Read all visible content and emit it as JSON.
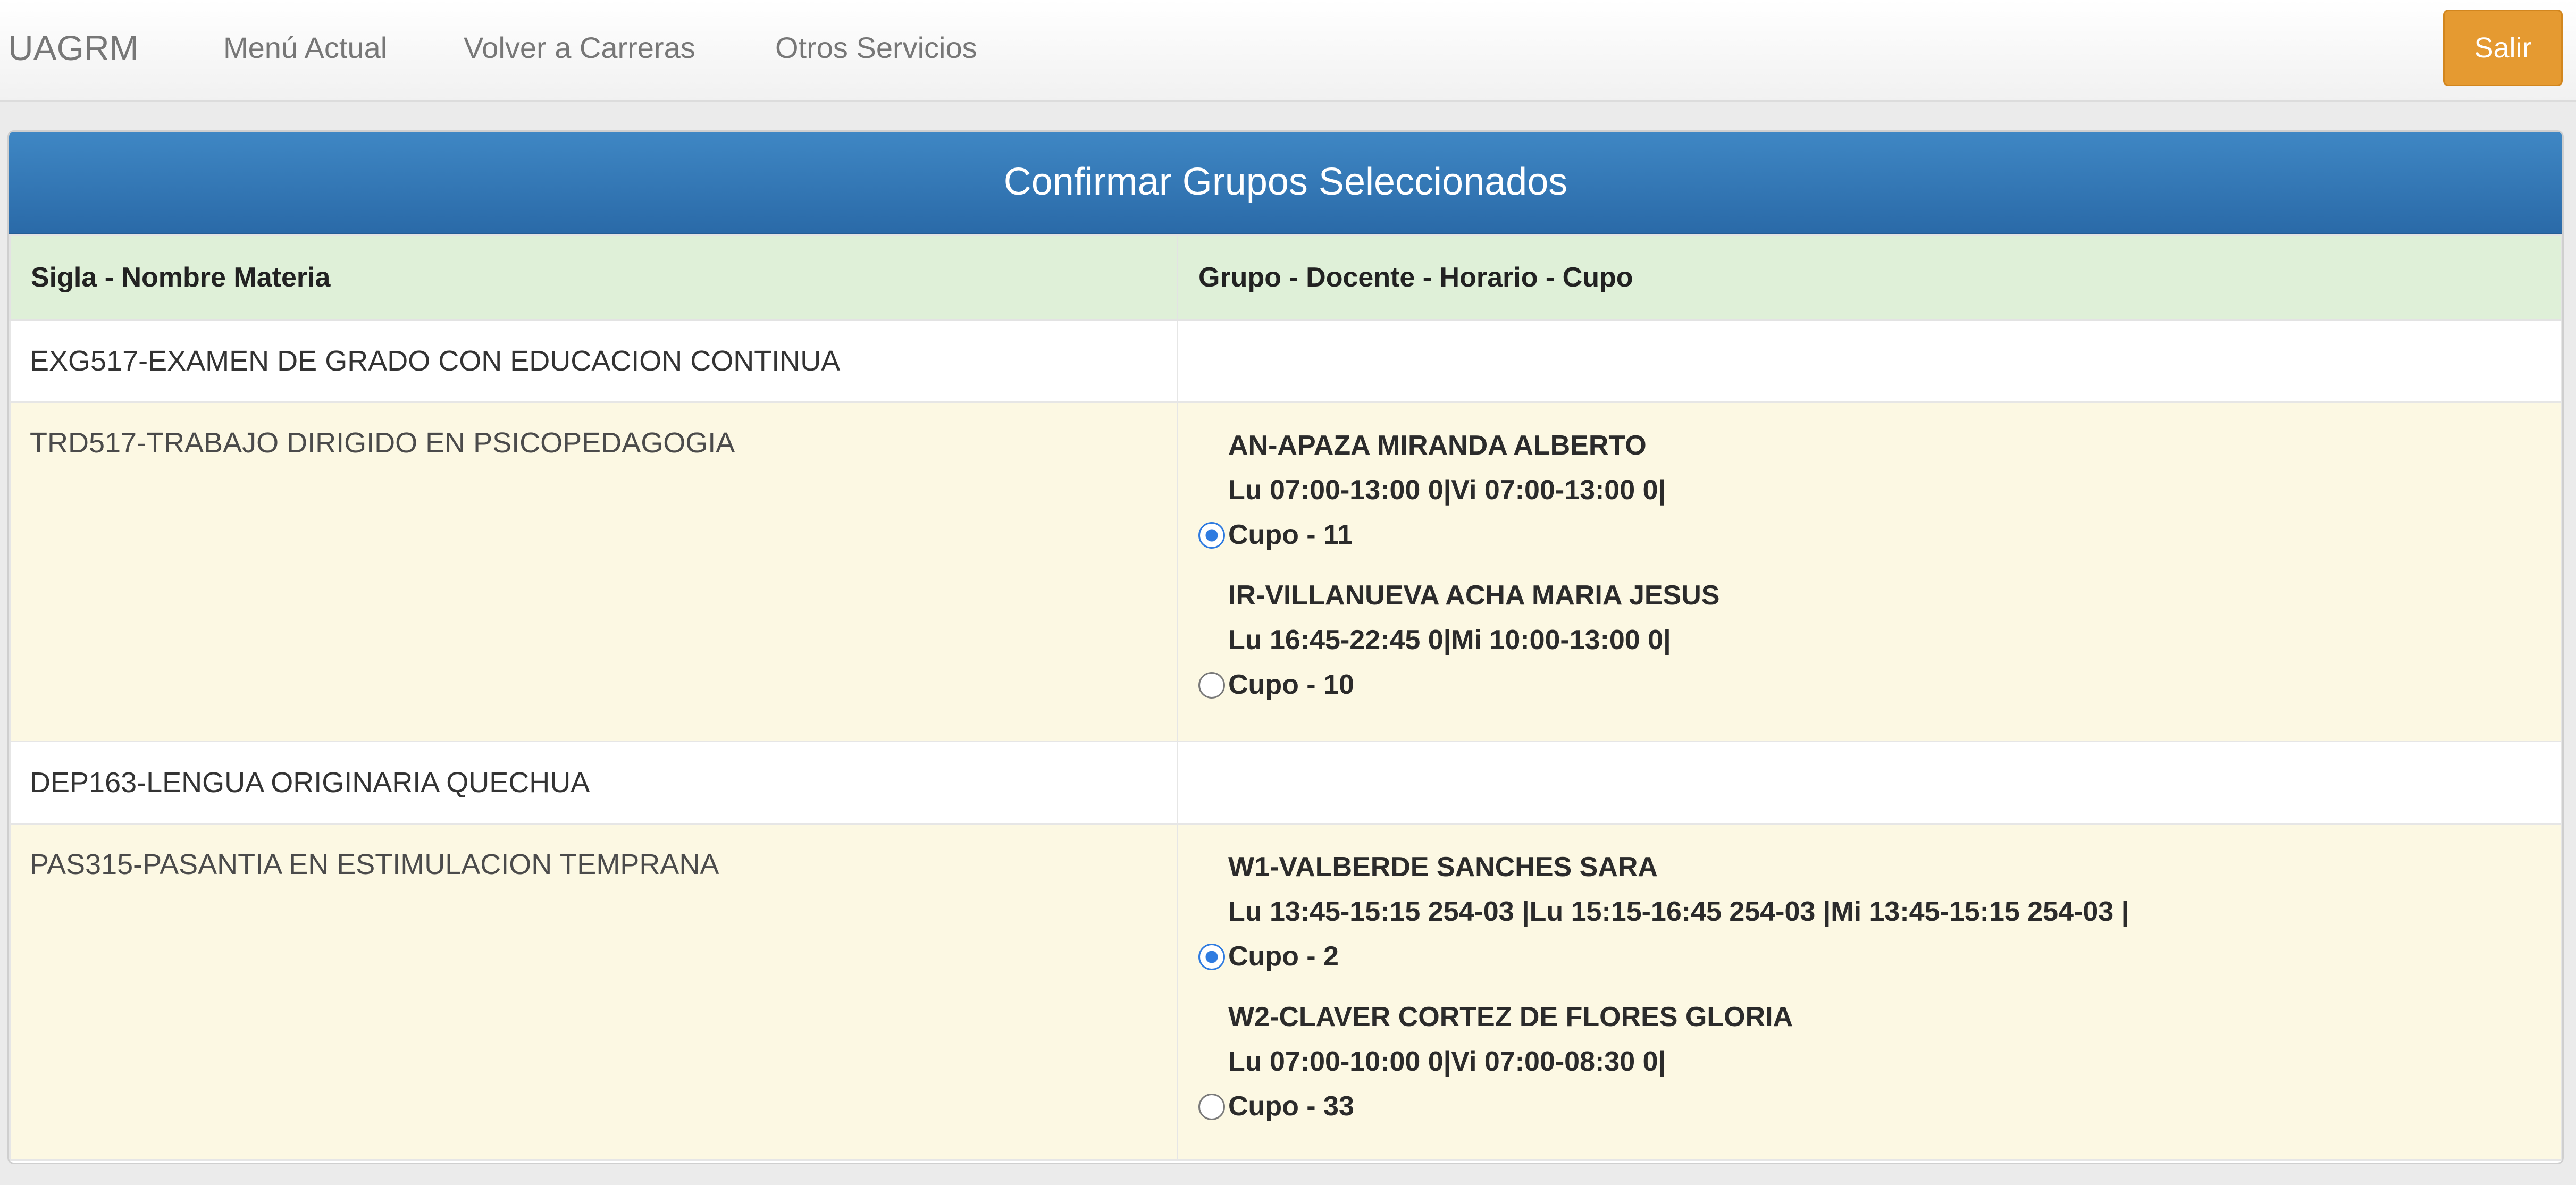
{
  "navbar": {
    "brand": "UAGRM",
    "links": [
      "Menú Actual",
      "Volver a Carreras",
      "Otros Servicios"
    ],
    "logout_label": "Salir"
  },
  "panel": {
    "title": "Confirmar Grupos Seleccionados"
  },
  "table": {
    "headers": [
      "Sigla - Nombre Materia",
      "Grupo - Docente - Horario - Cupo"
    ],
    "rows": [
      {
        "materia": "EXG517-EXAMEN DE GRADO CON EDUCACION CONTINUA",
        "groups": []
      },
      {
        "materia": "TRD517-TRABAJO DIRIGIDO EN PSICOPEDAGOGIA",
        "groups": [
          {
            "docente": "AN-APAZA MIRANDA ALBERTO",
            "horario": "Lu 07:00-13:00 0|Vi 07:00-13:00 0|",
            "cupo": "Cupo - 11",
            "selected": true
          },
          {
            "docente": "IR-VILLANUEVA ACHA MARIA JESUS",
            "horario": "Lu 16:45-22:45 0|Mi 10:00-13:00 0|",
            "cupo": "Cupo - 10",
            "selected": false
          }
        ]
      },
      {
        "materia": "DEP163-LENGUA ORIGINARIA QUECHUA",
        "groups": []
      },
      {
        "materia": "PAS315-PASANTIA EN ESTIMULACION TEMPRANA",
        "groups": [
          {
            "docente": "W1-VALBERDE SANCHES SARA",
            "horario": "Lu 13:45-15:15 254-03 |Lu 15:15-16:45 254-03 |Mi 13:45-15:15 254-03 |",
            "cupo": "Cupo - 2",
            "selected": true
          },
          {
            "docente": "W2-CLAVER CORTEZ DE FLORES GLORIA",
            "horario": "Lu 07:00-10:00 0|Vi 07:00-08:30 0|",
            "cupo": "Cupo - 33",
            "selected": false
          }
        ]
      }
    ]
  },
  "colors": {
    "navbar_bg": "#f7f7f7",
    "brand_text": "#777777",
    "logout_bg": "#e59a31",
    "panel_heading_bg": "#3a80bf",
    "table_header_bg": "#dff0d8",
    "warning_row_bg": "#fcf8e3",
    "radio_checked": "#2f7be0"
  }
}
